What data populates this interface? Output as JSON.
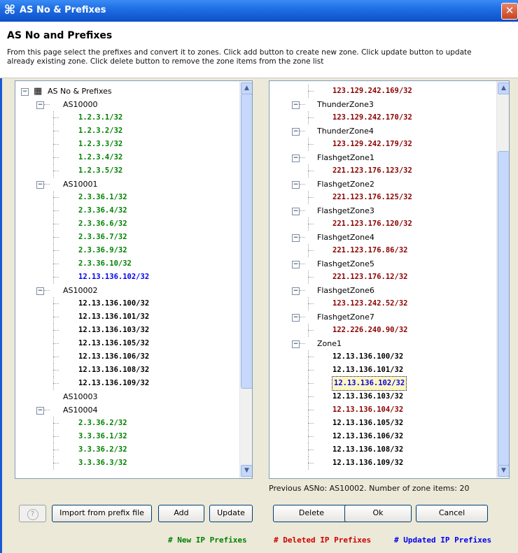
{
  "window": {
    "title": "AS No & Prefixes",
    "close_glyph": "✕",
    "app_icon": "⌘"
  },
  "header": {
    "title": "AS No and Prefixes",
    "description": "From this page select the prefixes and convert it to zones. Click add button to create new zone. Click update button to update already existing zone. Click delete button to remove the zone items from the zone list"
  },
  "colors": {
    "new": "#008000",
    "deleted": "#8b0000",
    "updated": "#0000ee",
    "titlebar": "#1f6fe6"
  },
  "left_tree": {
    "root": "AS No & Prefixes",
    "rows": [
      {
        "type": "node",
        "text": "AS10000",
        "expanded": true
      },
      {
        "type": "leaf",
        "text": "1.2.3.1/32",
        "color": "green"
      },
      {
        "type": "leaf",
        "text": "1.2.3.2/32",
        "color": "green"
      },
      {
        "type": "leaf",
        "text": "1.2.3.3/32",
        "color": "green"
      },
      {
        "type": "leaf",
        "text": "1.2.3.4/32",
        "color": "green"
      },
      {
        "type": "leaf",
        "text": "1.2.3.5/32",
        "color": "green"
      },
      {
        "type": "node",
        "text": "AS10001",
        "expanded": true
      },
      {
        "type": "leaf",
        "text": "2.3.36.1/32",
        "color": "green"
      },
      {
        "type": "leaf",
        "text": "2.3.36.4/32",
        "color": "green"
      },
      {
        "type": "leaf",
        "text": "2.3.36.6/32",
        "color": "green"
      },
      {
        "type": "leaf",
        "text": "2.3.36.7/32",
        "color": "green"
      },
      {
        "type": "leaf",
        "text": "2.3.36.9/32",
        "color": "green"
      },
      {
        "type": "leaf",
        "text": "2.3.36.10/32",
        "color": "green"
      },
      {
        "type": "leaf",
        "text": "12.13.136.102/32",
        "color": "blue"
      },
      {
        "type": "node",
        "text": "AS10002",
        "expanded": true
      },
      {
        "type": "leaf",
        "text": "12.13.136.100/32",
        "color": "black"
      },
      {
        "type": "leaf",
        "text": "12.13.136.101/32",
        "color": "black"
      },
      {
        "type": "leaf",
        "text": "12.13.136.103/32",
        "color": "black"
      },
      {
        "type": "leaf",
        "text": "12.13.136.105/32",
        "color": "black"
      },
      {
        "type": "leaf",
        "text": "12.13.136.106/32",
        "color": "black"
      },
      {
        "type": "leaf",
        "text": "12.13.136.108/32",
        "color": "black"
      },
      {
        "type": "leaf",
        "text": "12.13.136.109/32",
        "color": "black"
      },
      {
        "type": "node",
        "text": "AS10003",
        "expanded": null
      },
      {
        "type": "node",
        "text": "AS10004",
        "expanded": true
      },
      {
        "type": "leaf",
        "text": "2.3.36.2/32",
        "color": "green"
      },
      {
        "type": "leaf",
        "text": "3.3.36.1/32",
        "color": "green"
      },
      {
        "type": "leaf",
        "text": "3.3.36.2/32",
        "color": "green"
      },
      {
        "type": "leaf",
        "text": "3.3.36.3/32",
        "color": "green"
      }
    ]
  },
  "right_tree": {
    "rows": [
      {
        "type": "leaf",
        "text": "123.129.242.169/32",
        "color": "red"
      },
      {
        "type": "node",
        "text": "ThunderZone3",
        "expanded": true
      },
      {
        "type": "leaf",
        "text": "123.129.242.170/32",
        "color": "red"
      },
      {
        "type": "node",
        "text": "ThunderZone4",
        "expanded": true
      },
      {
        "type": "leaf",
        "text": "123.129.242.179/32",
        "color": "red"
      },
      {
        "type": "node",
        "text": "FlashgetZone1",
        "expanded": true
      },
      {
        "type": "leaf",
        "text": "221.123.176.123/32",
        "color": "red"
      },
      {
        "type": "node",
        "text": "FlashgetZone2",
        "expanded": true
      },
      {
        "type": "leaf",
        "text": "221.123.176.125/32",
        "color": "red"
      },
      {
        "type": "node",
        "text": "FlashgetZone3",
        "expanded": true
      },
      {
        "type": "leaf",
        "text": "221.123.176.120/32",
        "color": "red"
      },
      {
        "type": "node",
        "text": "FlashgetZone4",
        "expanded": true
      },
      {
        "type": "leaf",
        "text": "221.123.176.86/32",
        "color": "red"
      },
      {
        "type": "node",
        "text": "FlashgetZone5",
        "expanded": true
      },
      {
        "type": "leaf",
        "text": "221.123.176.12/32",
        "color": "red"
      },
      {
        "type": "node",
        "text": "FlashgetZone6",
        "expanded": true
      },
      {
        "type": "leaf",
        "text": "123.123.242.52/32",
        "color": "red"
      },
      {
        "type": "node",
        "text": "FlashgetZone7",
        "expanded": true
      },
      {
        "type": "leaf",
        "text": "122.226.240.90/32",
        "color": "red"
      },
      {
        "type": "node",
        "text": "Zone1",
        "expanded": true
      },
      {
        "type": "leaf",
        "text": "12.13.136.100/32",
        "color": "black"
      },
      {
        "type": "leaf",
        "text": "12.13.136.101/32",
        "color": "black"
      },
      {
        "type": "leaf",
        "text": "12.13.136.102/32",
        "color": "blue",
        "selected": true
      },
      {
        "type": "leaf",
        "text": "12.13.136.103/32",
        "color": "black"
      },
      {
        "type": "leaf",
        "text": "12.13.136.104/32",
        "color": "red"
      },
      {
        "type": "leaf",
        "text": "12.13.136.105/32",
        "color": "black"
      },
      {
        "type": "leaf",
        "text": "12.13.136.106/32",
        "color": "black"
      },
      {
        "type": "leaf",
        "text": "12.13.136.108/32",
        "color": "black"
      },
      {
        "type": "leaf",
        "text": "12.13.136.109/32",
        "color": "black"
      }
    ]
  },
  "status": "Previous ASNo: AS10002.  Number of zone items: 20",
  "buttons": {
    "help": "?",
    "import": "Import from prefix file",
    "add": "Add",
    "update": "Update",
    "delete": "Delete",
    "ok": "Ok",
    "cancel": "Cancel"
  },
  "legend": {
    "new": "# New IP Prefixes",
    "deleted": "# Deleted IP Prefixes",
    "updated": "# Updated IP Prefixes"
  }
}
